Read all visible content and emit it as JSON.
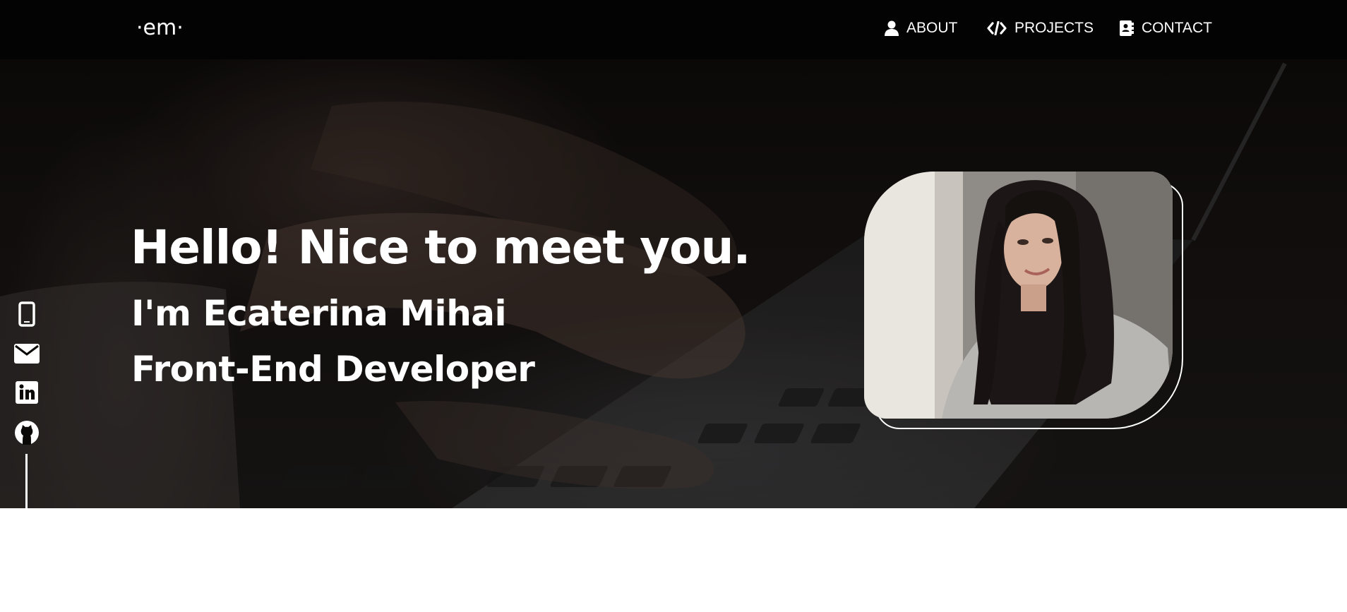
{
  "nav": {
    "logo": "·em·",
    "links": [
      {
        "label": "ABOUT",
        "icon": "user-icon"
      },
      {
        "label": "PROJECTS",
        "icon": "code-icon"
      },
      {
        "label": "CONTACT",
        "icon": "address-book-icon"
      }
    ]
  },
  "hero": {
    "heading": "Hello! Nice to meet you.",
    "name_line": "I'm Ecaterina Mihai",
    "role_line": "Front-End Developer",
    "background_image": "hands-typing-on-laptop-photo",
    "portrait_image": "profile-photo"
  },
  "social": [
    {
      "icon": "phone-icon"
    },
    {
      "icon": "envelope-icon"
    },
    {
      "icon": "linkedin-icon"
    },
    {
      "icon": "github-icon"
    }
  ],
  "colors": {
    "nav_bg": "#030303",
    "hero_overlay": "#0e0b0a",
    "text": "#ffffff",
    "page_bg": "#ffffff"
  }
}
